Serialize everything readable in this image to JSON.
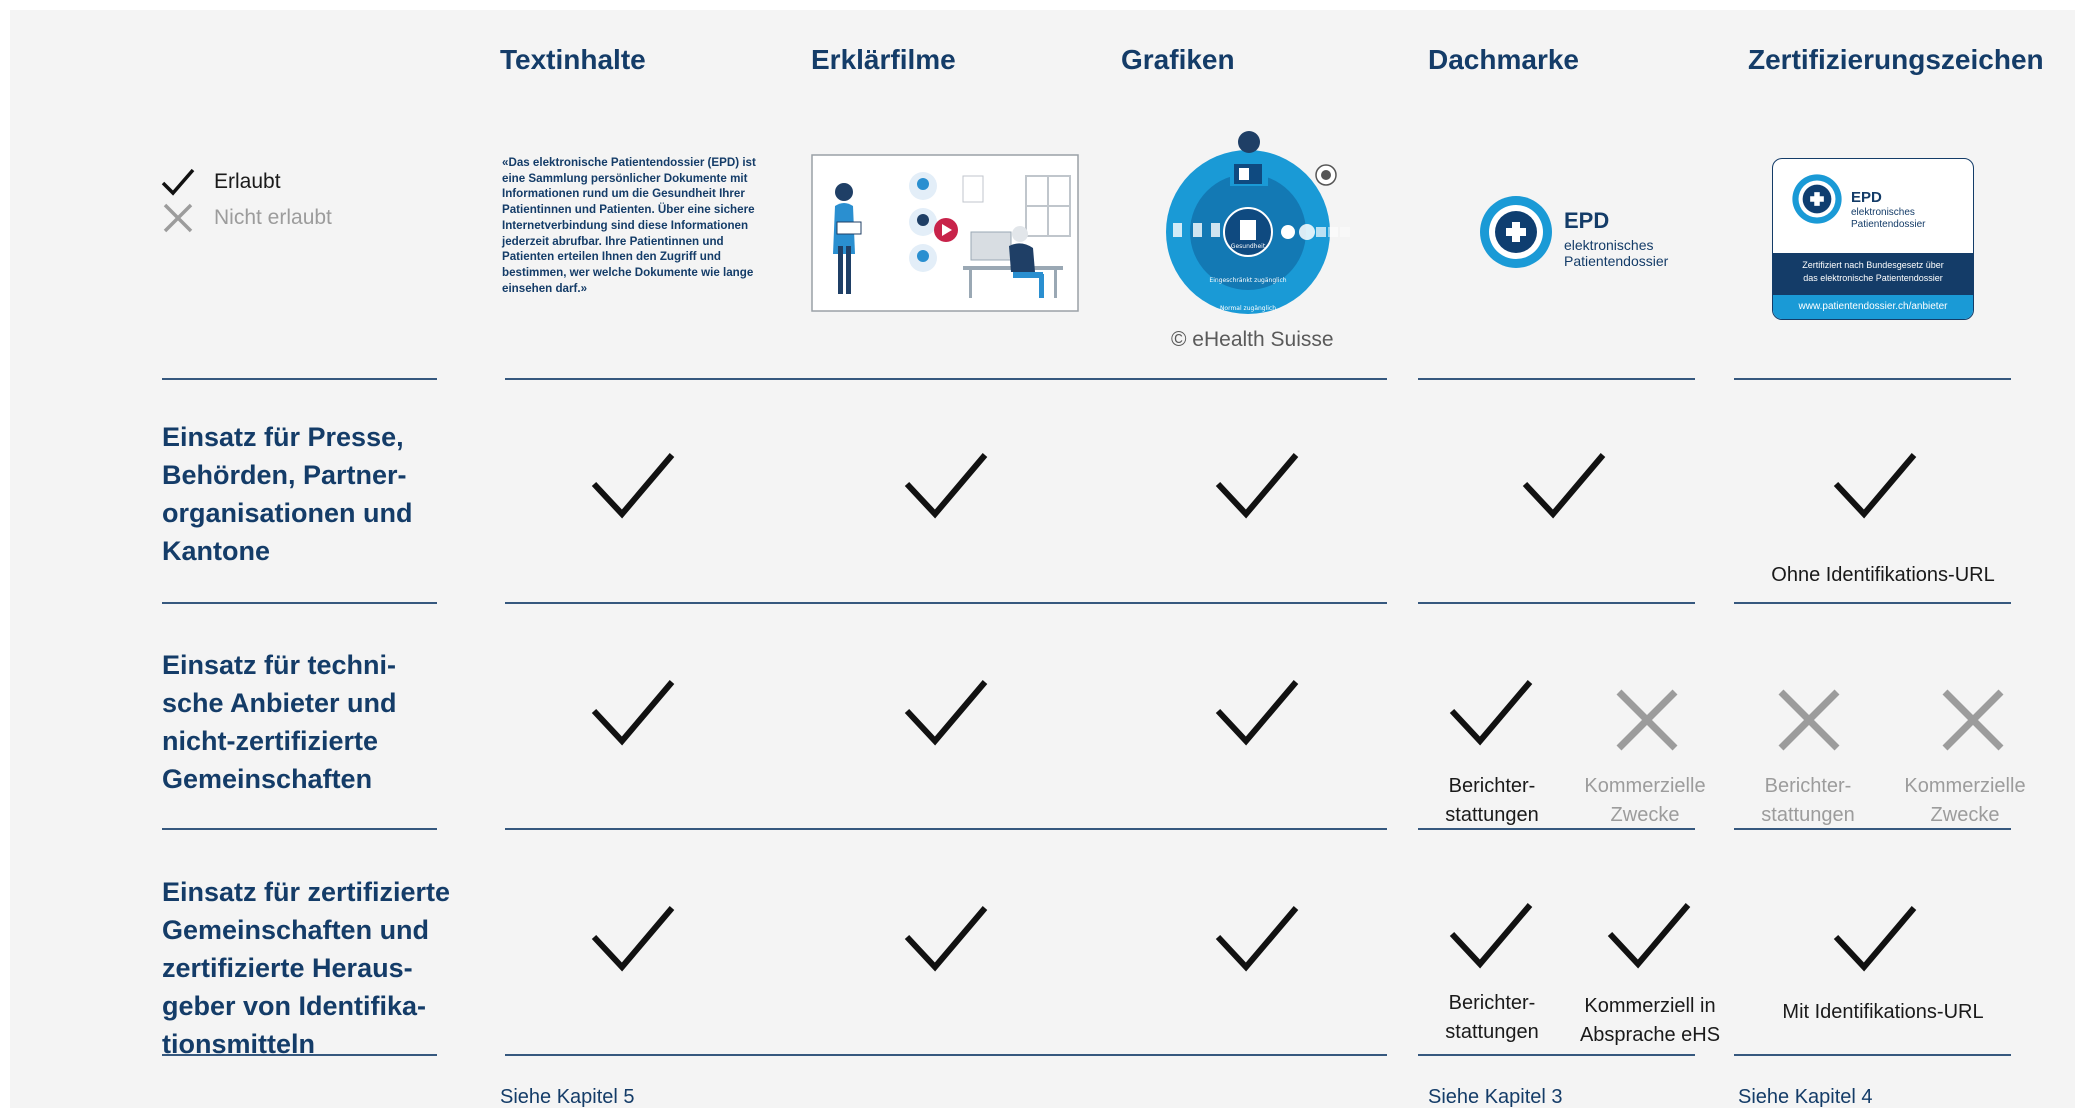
{
  "columns": [
    {
      "id": "textinhalte",
      "label": "Textinhalte"
    },
    {
      "id": "erklaerfilme",
      "label": "Erklärfilme"
    },
    {
      "id": "grafiken",
      "label": "Grafiken"
    },
    {
      "id": "dachmarke",
      "label": "Dachmarke"
    },
    {
      "id": "zertifizierungszeichen",
      "label": "Zertifizierungszeichen"
    }
  ],
  "legend": {
    "allowed": "Erlaubt",
    "not_allowed": "Nicht erlaubt"
  },
  "sample_text": "«Das elektronische Patientendossier (EPD) ist eine Sammlung persönlicher Dokumente mit Informationen rund um die Gesundheit Ihrer Patientinnen und Patienten. Über eine sichere Internetverbindung sind diese Informationen jederzeit abrufbar. Ihre Patientinnen und Patienten erteilen Ihnen den Zugriff und bestimmen, wer welche Dokumente wie lange einsehen darf.»",
  "grafik": {
    "copyright": "© eHealth Suisse",
    "ring_top": "Gesundheit",
    "ring_bottom": "Eingeschränkt zugänglich",
    "ring_outer": "Normal zugänglich"
  },
  "dachmarke_logo": {
    "title": "EPD",
    "line1": "elektronisches",
    "line2": "Patientendossier"
  },
  "zert_logo": {
    "title": "EPD",
    "line1": "elektronisches",
    "line2": "Patientendossier",
    "band_line1": "Zertifiziert nach Bundesgesetz über",
    "band_line2": "das elektronische Patientendossier",
    "url": "www.patientendossier.ch/anbieter"
  },
  "rows": [
    {
      "label_lines": [
        "Einsatz für Presse,",
        "Behörden, Partner-",
        "organisationen und",
        "Kantone"
      ],
      "cells": [
        "allowed",
        "allowed",
        "allowed",
        "allowed",
        "allowed"
      ],
      "zert_caption": "Ohne Identifikations-URL"
    },
    {
      "label_lines": [
        "Einsatz für techni-",
        "sche Anbieter und",
        "nicht-zertifizierte",
        "Gemeinschaften"
      ],
      "cells": [
        "allowed",
        "allowed",
        "allowed"
      ],
      "dach": [
        {
          "mark": "allowed",
          "caption": [
            "Berichter-",
            "stattungen"
          ]
        },
        {
          "mark": "not_allowed",
          "caption": [
            "Kommerzielle",
            "Zwecke"
          ]
        }
      ],
      "zert": [
        {
          "mark": "not_allowed",
          "caption": [
            "Berichter-",
            "stattungen"
          ]
        },
        {
          "mark": "not_allowed",
          "caption": [
            "Kommerzielle",
            "Zwecke"
          ]
        }
      ]
    },
    {
      "label_lines": [
        "Einsatz für zertifizierte",
        "Gemeinschaften und",
        "zertifizierte Heraus-",
        "geber von Identifika-",
        "tionsmitteln"
      ],
      "cells": [
        "allowed",
        "allowed",
        "allowed"
      ],
      "dach": [
        {
          "mark": "allowed",
          "caption": [
            "Berichter-",
            "stattungen"
          ]
        },
        {
          "mark": "allowed",
          "caption": [
            "Kommerziell in",
            "Absprache eHS"
          ]
        }
      ],
      "zert_caption": "Mit Identifikations-URL"
    }
  ],
  "footer": {
    "kap5": "Siehe Kapitel 5",
    "kap3": "Siehe Kapitel 3",
    "kap4": "Siehe Kapitel 4"
  },
  "colors": {
    "navy": "#143c68",
    "blue": "#1a9ad6",
    "gray": "#9c9c9c",
    "check": "#111111"
  }
}
